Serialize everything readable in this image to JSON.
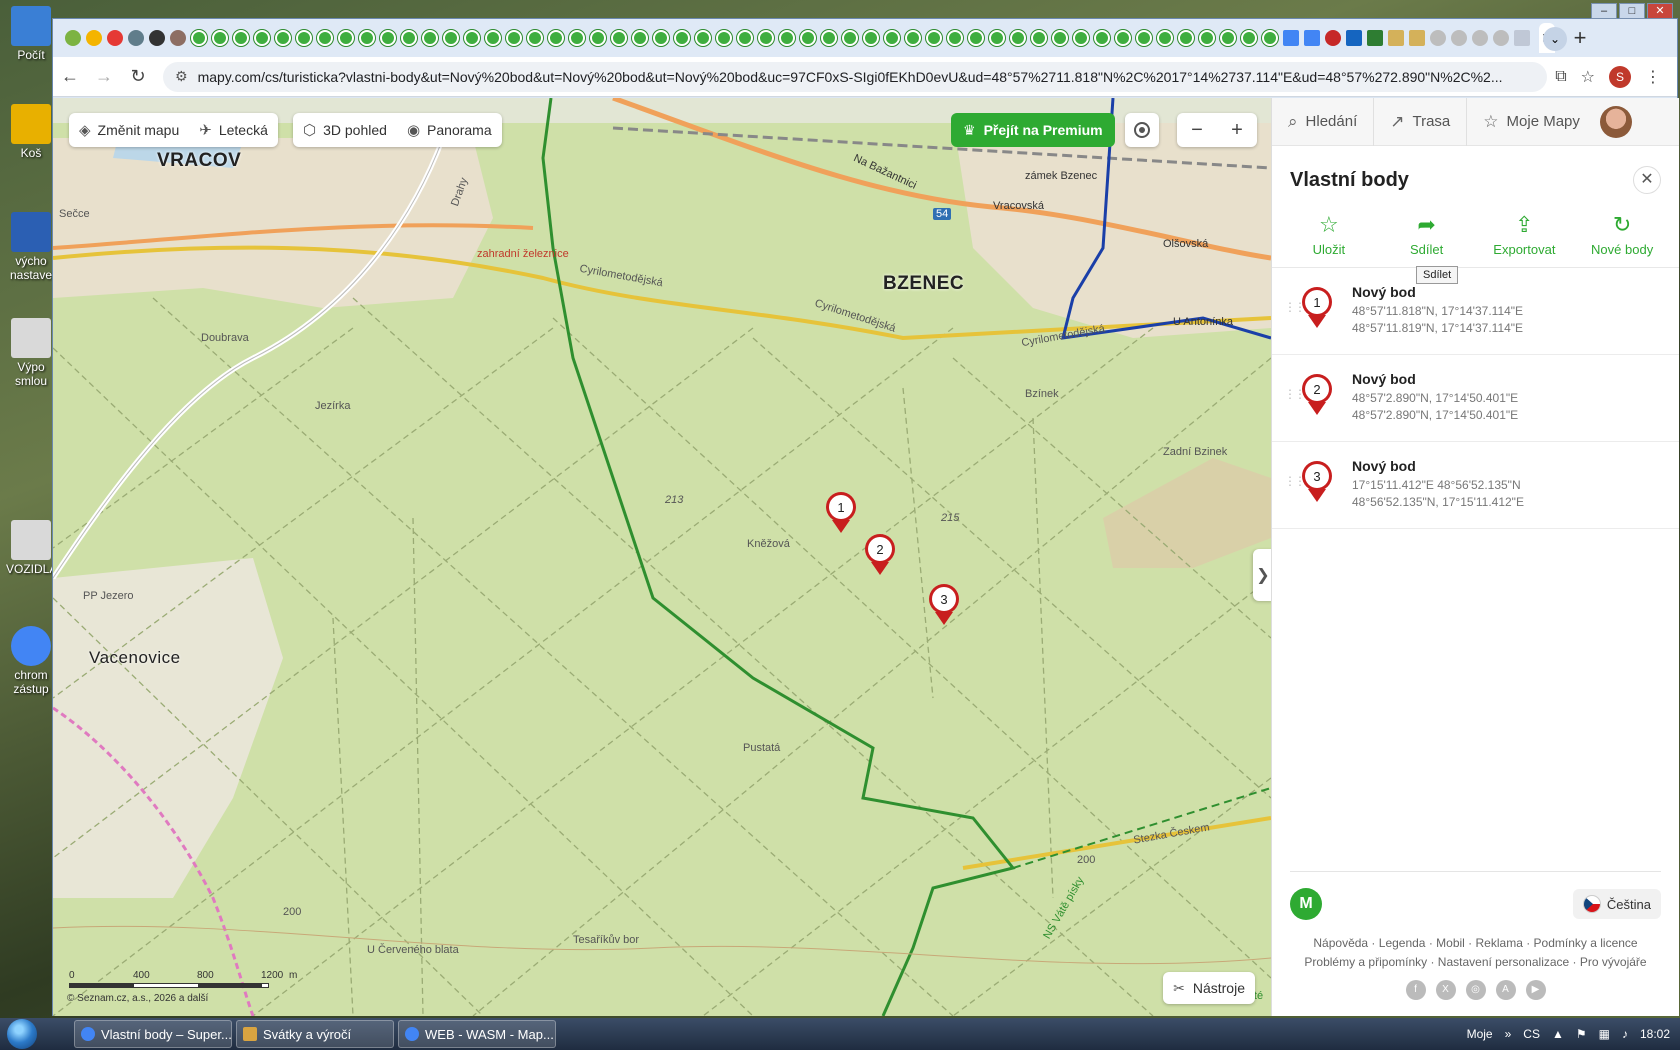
{
  "desktop": {
    "icons": [
      {
        "label": "Počít",
        "color": "#3a7fd5"
      },
      {
        "label": "Koš",
        "color": "#e8b000"
      },
      {
        "label": "výcho nastave",
        "color": "#2b5fb3"
      },
      {
        "label": "Výpo smlou",
        "color": "#d9d9d9"
      },
      {
        "label": "VOZIDLA",
        "color": "#d9d9d9"
      },
      {
        "label": "chrom zástup",
        "color": "#4285f4"
      }
    ]
  },
  "browser": {
    "url": "mapy.com/cs/turisticka?vlastni-body&ut=Nový%20bod&ut=Nový%20bod&ut=Nový%20bod&uc=97CF0xS-SIgi0fEKhD0evU&ud=48°57%2711.818\"N%2C%2017°14%2737.114\"E&ud=48°57%272.890\"N%2C%2...",
    "active_tab_close": "✕",
    "profile_initial": "S"
  },
  "map": {
    "controls": {
      "change_map": "Změnit mapu",
      "aerial": "Letecká",
      "view_3d": "3D pohled",
      "panorama": "Panorama",
      "premium": "Přejít na Premium",
      "zoom_out": "−",
      "zoom_in": "+",
      "tools": "Nástroje"
    },
    "places": {
      "vracov": "VRACOV",
      "bzenec": "BZENEC",
      "vacenovice": "Vacenovice",
      "jezero": "PP Jezero",
      "zeleznice": "zahradní železnice",
      "vracovska": "Vracovská",
      "olsovska": "Olšovská",
      "antoninka": "U Antonínka",
      "cyril1": "Cyrilometodějská",
      "cyril2": "Cyrilometodějská",
      "cyril3": "Cyrilometodějská",
      "bazantnici": "Na Bažantnici",
      "zamek": "zámek Bzenec",
      "bzinek": "Bzínek",
      "zadni": "Zadní Bzinek",
      "doubrava": "Doubrava",
      "jezirka": "Jezírka",
      "secce": "Sečce",
      "drahy": "Drahy",
      "kenezova": "Kněžová",
      "pustata": "Pustatá",
      "tesarikuv": "Tesaříkův bor",
      "cerveneho": "U Červeného blata",
      "stezka": "Stezka Českem",
      "ns_vate": "NS Vátě písky",
      "npp": "NPP Váté",
      "h213": "213",
      "h215": "215",
      "h200a": "200",
      "h200b": "200",
      "road54": "54"
    },
    "scale": {
      "ticks": [
        "0",
        "400",
        "800",
        "1200"
      ],
      "unit": "m"
    },
    "copyright": "© Seznam.cz, a.s., 2026 a další",
    "pins": [
      {
        "number": "1"
      },
      {
        "number": "2"
      },
      {
        "number": "3"
      }
    ],
    "collapse_glyph": "❯"
  },
  "panel": {
    "nav": {
      "search": "Hledání",
      "route": "Trasa",
      "my_maps": "Moje Mapy"
    },
    "title": "Vlastní body",
    "close": "✕",
    "actions": {
      "save": "Uložit",
      "share": "Sdílet",
      "export": "Exportovat",
      "new_points": "Nové body"
    },
    "tooltip": "Sdílet",
    "points": [
      {
        "number": "1",
        "name": "Nový bod",
        "coord1": "48°57'11.818\"N, 17°14'37.114\"E",
        "coord2": "48°57'11.819\"N, 17°14'37.114\"E"
      },
      {
        "number": "2",
        "name": "Nový bod",
        "coord1": "48°57'2.890\"N, 17°14'50.401\"E",
        "coord2": "48°57'2.890\"N, 17°14'50.401\"E"
      },
      {
        "number": "3",
        "name": "Nový bod",
        "coord1": "17°15'11.412\"E 48°56'52.135\"N",
        "coord2": "48°56'52.135\"N, 17°15'11.412\"E"
      }
    ],
    "footer": {
      "logo": "M",
      "language": "Čeština",
      "links1": [
        "Nápověda",
        "Legenda",
        "Mobil",
        "Reklama",
        "Podmínky a licence"
      ],
      "links2": [
        "Problémy a připomínky",
        "Nastavení personalizace",
        "Pro vývojáře"
      ],
      "socials": [
        "f",
        "X",
        "◎",
        "A",
        "▶"
      ]
    }
  },
  "taskbar": {
    "tasks": [
      {
        "label": "Vlastní body – Super...",
        "color": "#4285f4"
      },
      {
        "label": "Svátky a výročí",
        "color": "#d9a441"
      },
      {
        "label": "WEB - WASM - Map...",
        "color": "#4285f4"
      }
    ],
    "tray": {
      "moje": "Moje",
      "lang": "CS",
      "time": "18:02"
    }
  }
}
